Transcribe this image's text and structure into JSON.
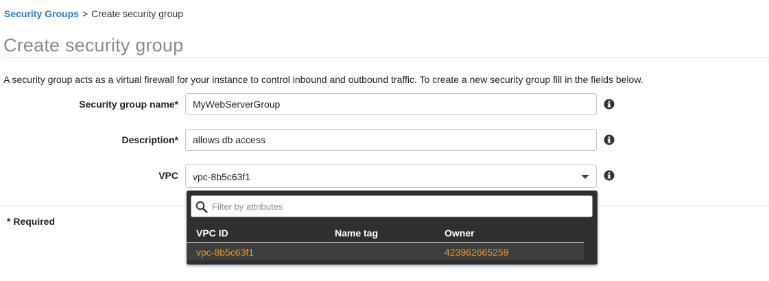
{
  "breadcrumb": {
    "link": "Security Groups",
    "separator": ">",
    "current": "Create security group"
  },
  "page_title": "Create security group",
  "intro_text": "A security group acts as a virtual firewall for your instance to control inbound and outbound traffic. To create a new security group fill in the fields below.",
  "form": {
    "name_label": "Security group name*",
    "name_value": "MyWebServerGroup",
    "description_label": "Description*",
    "description_value": "allows db access",
    "vpc_label": "VPC",
    "vpc_value": "vpc-8b5c63f1"
  },
  "required_note": "* Required",
  "vpc_dropdown": {
    "filter_placeholder": "Filter by attributes",
    "columns": [
      "VPC ID",
      "Name tag",
      "Owner"
    ],
    "rows": [
      {
        "vpc_id": "vpc-8b5c63f1",
        "name_tag": "",
        "owner": "423962665259"
      }
    ]
  },
  "colors": {
    "link": "#2d7bc4",
    "dropdown_bg": "#2f2f2f",
    "highlight_text": "#ec9b1f"
  },
  "icons": [
    "info-icon",
    "chevron-down-icon",
    "search-icon"
  ]
}
